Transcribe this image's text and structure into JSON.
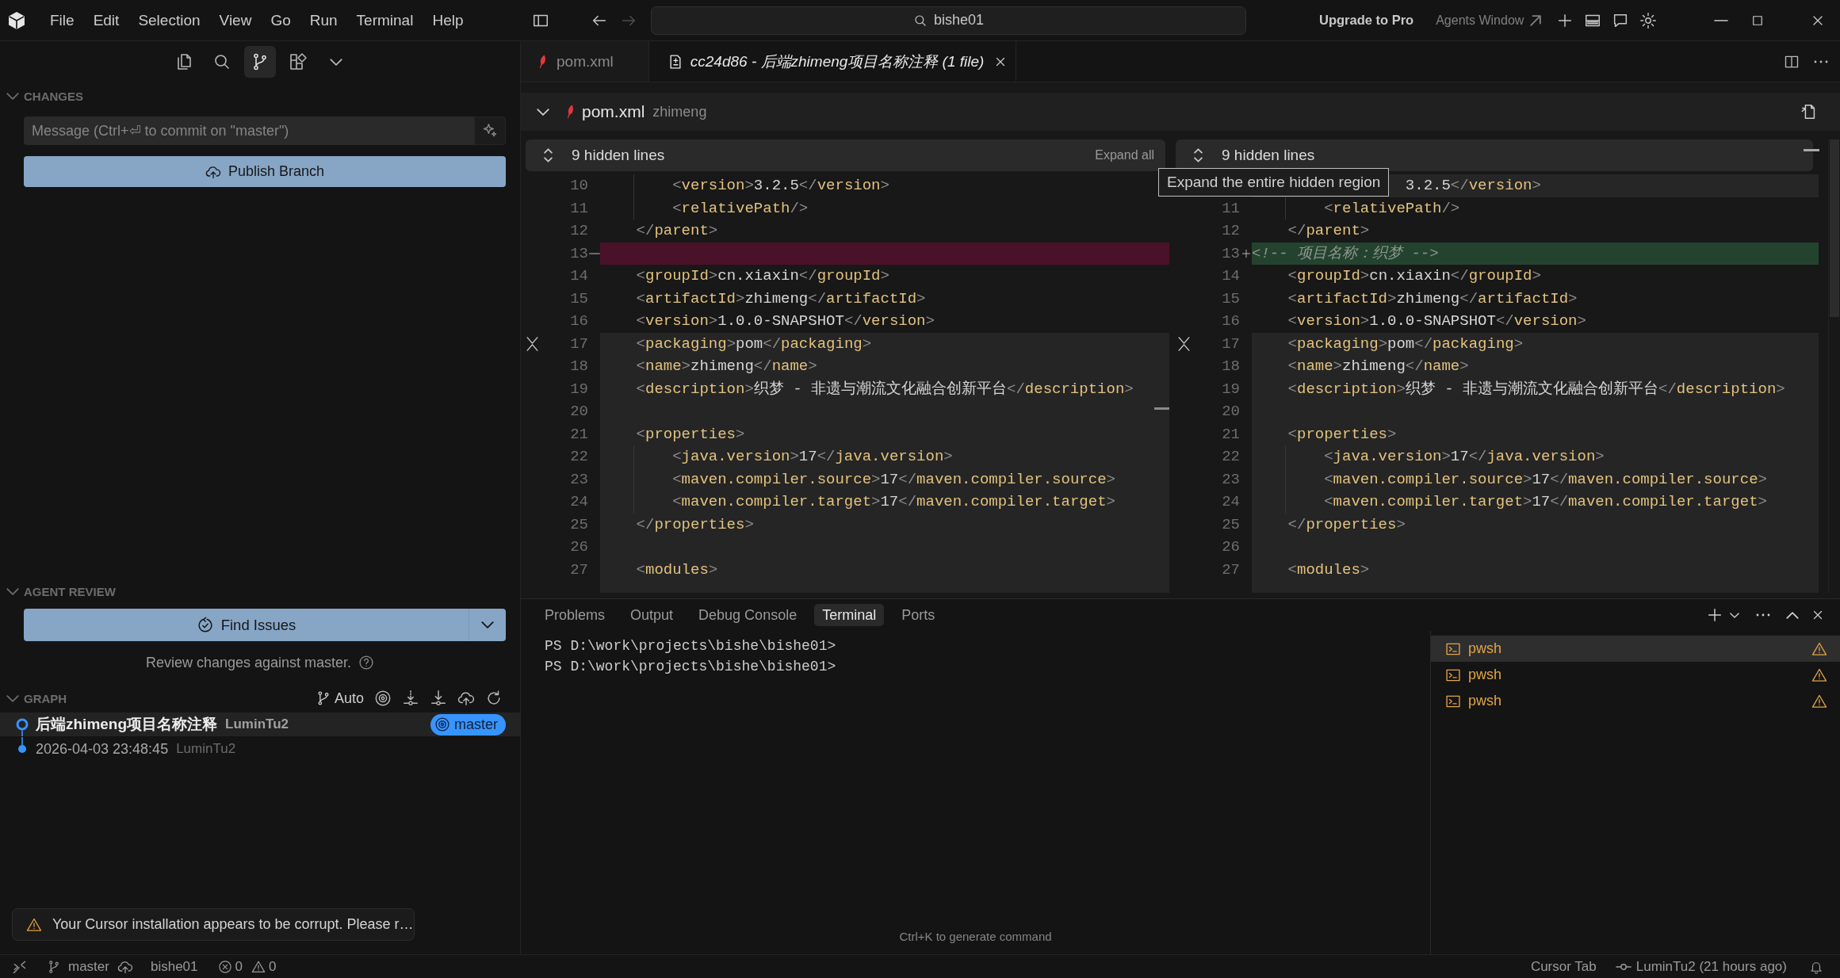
{
  "title_bar": {
    "menu": [
      "File",
      "Edit",
      "Selection",
      "View",
      "Go",
      "Run",
      "Terminal",
      "Help"
    ],
    "search": {
      "value": "bishe01"
    },
    "upgrade": "Upgrade to Pro",
    "agents_window": "Agents Window"
  },
  "sidebar": {
    "activity_tabs": [
      {
        "kind": "explorer",
        "selected": false
      },
      {
        "kind": "search",
        "selected": false
      },
      {
        "kind": "source_control",
        "selected": true
      },
      {
        "kind": "extensions",
        "selected": false
      },
      {
        "kind": "more",
        "selected": false
      }
    ],
    "changes": {
      "title": "CHANGES",
      "expanded": true,
      "message": {
        "placeholder": "Message (Ctrl+⏎ to commit on \"master\")"
      },
      "publish_button": "Publish Branch"
    },
    "agent_review": {
      "title": "AGENT REVIEW",
      "expanded": true,
      "button": "Find Issues",
      "hint": "Review changes against master."
    },
    "graph": {
      "title": "GRAPH",
      "expanded": true,
      "mode": "Auto",
      "commits": [
        {
          "kind": "head",
          "message": "后端zhimeng项目名称注释",
          "author": "LuminTu2",
          "branch": "master",
          "selected": true
        },
        {
          "kind": "commit",
          "message": "2026-04-03 23:48:45",
          "author": "LuminTu2",
          "selected": false
        }
      ]
    },
    "notification": {
      "text": "Your Cursor installation appears to be corrupt. Please r…"
    }
  },
  "editor": {
    "tabs": [
      {
        "kind": "file",
        "label": "pom.xml",
        "selected": false,
        "preview": false
      },
      {
        "kind": "diff",
        "label": "cc24d86 - 后端zhimeng项目名称注释 (1 file)",
        "selected": true,
        "preview": true
      }
    ],
    "file_header": {
      "expanded": true,
      "name": "pom.xml",
      "folder": "zhimeng"
    },
    "panes": [
      {
        "hidden_lines": "9 hidden lines",
        "expand_all": "Expand all",
        "blocks": [
          {
            "collapsible": false,
            "lines": [
              {
                "number": "10",
                "kind": "context",
                "text": "        <version>3.2.5</version>"
              },
              {
                "number": "11",
                "kind": "context",
                "text": "        <relativePath/>"
              },
              {
                "number": "12",
                "kind": "context",
                "text": "    </parent>"
              },
              {
                "number": "13",
                "kind": "removed"
              },
              {
                "number": "14",
                "kind": "context",
                "text": "    <groupId>cn.xiaxin</groupId>"
              },
              {
                "number": "15",
                "kind": "context",
                "text": "    <artifactId>zhimeng</artifactId>"
              },
              {
                "number": "16",
                "kind": "context",
                "text": "    <version>1.0.0-SNAPSHOT</version>"
              }
            ]
          },
          {
            "collapsible": true,
            "lines": [
              {
                "number": "17",
                "kind": "context",
                "text": "    <packaging>pom</packaging>"
              },
              {
                "number": "18",
                "kind": "context",
                "text": "    <name>zhimeng</name>"
              },
              {
                "number": "19",
                "kind": "context",
                "text": "    <description>织梦 - 非遗与潮流文化融合创新平台</description>"
              },
              {
                "number": "20",
                "kind": "context"
              },
              {
                "number": "21",
                "kind": "context",
                "text": "    <properties>"
              },
              {
                "number": "22",
                "kind": "context",
                "text": "        <java.version>17</java.version>"
              },
              {
                "number": "23",
                "kind": "context",
                "text": "        <maven.compiler.source>17</maven.compiler.source>"
              },
              {
                "number": "24",
                "kind": "context",
                "text": "        <maven.compiler.target>17</maven.compiler.target>"
              },
              {
                "number": "25",
                "kind": "context",
                "text": "    </properties>"
              },
              {
                "number": "26",
                "kind": "context"
              },
              {
                "number": "27",
                "kind": "context",
                "text": "    <modules>"
              }
            ]
          }
        ]
      },
      {
        "hidden_lines": "9 hidden lines",
        "blocks": [
          {
            "collapsible": false,
            "lines": [
              {
                "kind": "hovered",
                "text": "                 3.2.5</version>"
              },
              {
                "number": "11",
                "kind": "context",
                "text": "        <relativePath/>"
              },
              {
                "number": "12",
                "kind": "context",
                "text": "    </parent>"
              },
              {
                "number": "13",
                "kind": "added",
                "text": "<!-- 项目名称：织梦 -->"
              },
              {
                "number": "14",
                "kind": "context",
                "text": "    <groupId>cn.xiaxin</groupId>"
              },
              {
                "number": "15",
                "kind": "context",
                "text": "    <artifactId>zhimeng</artifactId>"
              },
              {
                "number": "16",
                "kind": "context",
                "text": "    <version>1.0.0-SNAPSHOT</version>"
              }
            ]
          },
          {
            "collapsible": true,
            "lines": [
              {
                "number": "17",
                "kind": "context",
                "text": "    <packaging>pom</packaging>"
              },
              {
                "number": "18",
                "kind": "context",
                "text": "    <name>zhimeng</name>"
              },
              {
                "number": "19",
                "kind": "context",
                "text": "    <description>织梦 - 非遗与潮流文化融合创新平台</description>"
              },
              {
                "number": "20",
                "kind": "context"
              },
              {
                "number": "21",
                "kind": "context",
                "text": "    <properties>"
              },
              {
                "number": "22",
                "kind": "context",
                "text": "        <java.version>17</java.version>"
              },
              {
                "number": "23",
                "kind": "context",
                "text": "        <maven.compiler.source>17</maven.compiler.source>"
              },
              {
                "number": "24",
                "kind": "context",
                "text": "        <maven.compiler.target>17</maven.compiler.target>"
              },
              {
                "number": "25",
                "kind": "context",
                "text": "    </properties>"
              },
              {
                "number": "26",
                "kind": "context"
              },
              {
                "number": "27",
                "kind": "context",
                "text": "    <modules>"
              }
            ]
          }
        ]
      }
    ],
    "tooltip": "Expand the entire hidden region"
  },
  "panel": {
    "tabs": [
      {
        "label": "Problems",
        "selected": false
      },
      {
        "label": "Output",
        "selected": false
      },
      {
        "label": "Debug Console",
        "selected": false
      },
      {
        "label": "Terminal",
        "selected": true
      },
      {
        "label": "Ports",
        "selected": false
      }
    ],
    "terminal": {
      "lines": [
        "PS D:\\work\\projects\\bishe\\bishe01>",
        "PS D:\\work\\projects\\bishe\\bishe01>"
      ],
      "hint": "Ctrl+K to generate command"
    },
    "terminals": [
      {
        "label": "pwsh",
        "selected": true,
        "warning": true
      },
      {
        "label": "pwsh",
        "selected": false,
        "warning": true
      },
      {
        "label": "pwsh",
        "selected": false,
        "warning": true
      }
    ]
  },
  "status_bar": {
    "branch": "master",
    "workspace": "bishe01",
    "errors": "0",
    "warnings": "0",
    "cursor_tab": "Cursor Tab",
    "blame": "LuminTu2 (21 hours ago)"
  }
}
